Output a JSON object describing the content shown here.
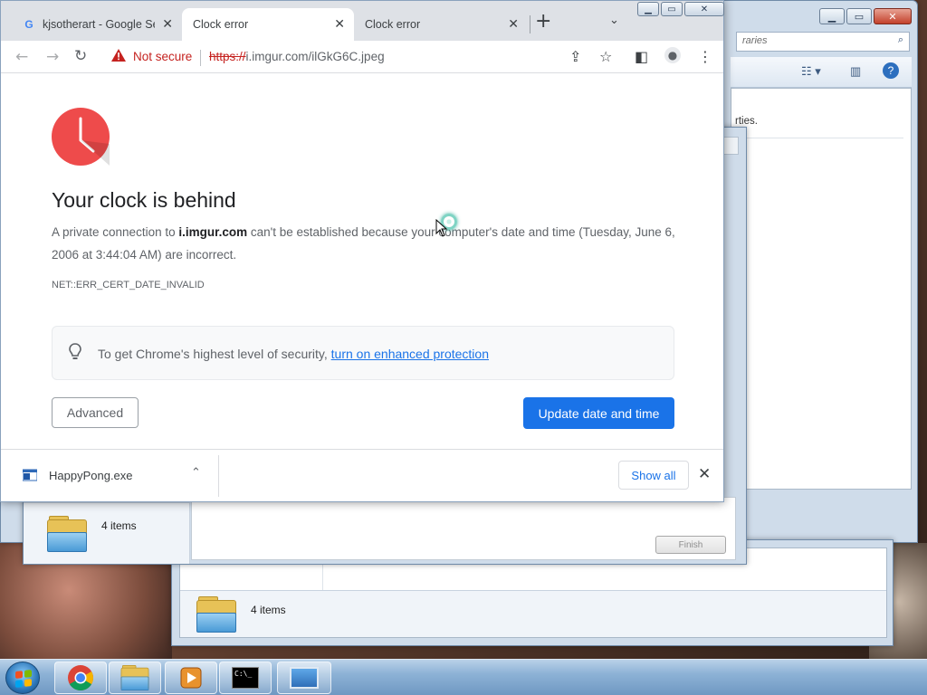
{
  "chrome": {
    "tabs": [
      {
        "title": "kjsotherart - Google Se",
        "favicon": "google-g-icon"
      },
      {
        "title": "Clock error"
      },
      {
        "title": "Clock error"
      }
    ],
    "security_label": "Not secure",
    "url_scheme": "https://",
    "url_rest": "i.imgur.com/ilGkG6C.jpeg"
  },
  "error_page": {
    "headline": "Your clock is behind",
    "desc_part1": "A private connection to ",
    "desc_host": "i.imgur.com",
    "desc_part2": " can't be established because your computer's date and time (Tuesday, June 6, 2006 at 3:44:04 AM) are incorrect.",
    "error_code": "NET::ERR_CERT_DATE_INVALID",
    "enhanced_text": "To get Chrome's highest level of security, ",
    "enhanced_link": "turn on enhanced protection",
    "advanced_button": "Advanced",
    "update_button": "Update date and time"
  },
  "download_bar": {
    "file_name": "HappyPong.exe",
    "show_all": "Show all"
  },
  "explorer": {
    "search_placeholder": "raries",
    "side_text": "rties.",
    "items_count_1": "4 items",
    "items_count_2": "4 items",
    "finish_button": "Finish"
  },
  "colors": {
    "primary": "#1a73e8",
    "danger": "#c5221f",
    "clock_red": "#ee4b4b"
  }
}
